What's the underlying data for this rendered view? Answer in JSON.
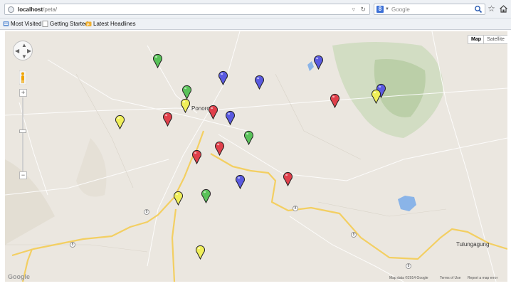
{
  "browser": {
    "url": {
      "host": "localhost",
      "path": "/peta/"
    },
    "search": {
      "engine_badge": "8",
      "placeholder": "Google"
    },
    "icons": [
      "globe-icon",
      "dropdown-arrow-icon",
      "reload-icon",
      "search-engine-icon",
      "search-icon",
      "bookmark-star-icon",
      "home-icon"
    ]
  },
  "bookmarks": [
    {
      "label": "Most Visited",
      "icon": "most-visited-icon"
    },
    {
      "label": "Getting Started",
      "icon": "page-icon"
    },
    {
      "label": "Latest Headlines",
      "icon": "rss-folder-icon"
    }
  ],
  "map": {
    "type_buttons": [
      {
        "label": "Map",
        "active": true
      },
      {
        "label": "Satellite",
        "active": false
      }
    ],
    "zoom": {
      "in": "+",
      "out": "−"
    },
    "city_labels": [
      "Ponorogo",
      "Tulungagung"
    ],
    "logo": "Google",
    "attribution": [
      "Map data ©2014 Google",
      "Terms of Use",
      "Report a map error"
    ],
    "road_numbers": [
      "8",
      "8",
      "8",
      "8",
      "8"
    ],
    "marker_colors": {
      "green": "#59c259",
      "blue": "#5a5ae0",
      "red": "#e0404b",
      "yellow": "#f0ef5a"
    },
    "marker_counts": {
      "green": 5,
      "blue": 6,
      "red": 7,
      "yellow": 6
    }
  }
}
